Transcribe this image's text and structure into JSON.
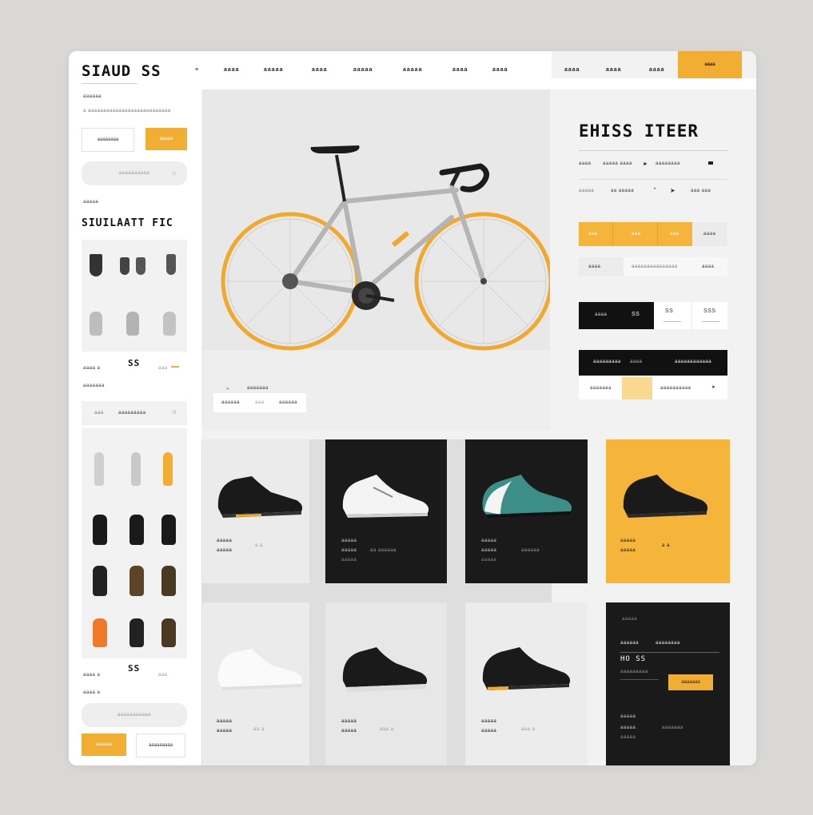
{
  "brand": {
    "logo": "SIAUD SS"
  },
  "nav": {
    "items": [
      "aaaa",
      "aaaaa",
      "aaaa",
      "aaaaa",
      "aaaaa",
      "aaaa",
      "aaaa"
    ],
    "right_items": [
      "aaaa",
      "aaaa",
      "aaaa"
    ],
    "cta_label": "aaaa"
  },
  "sidebar": {
    "eyebrow": "aaaaaa",
    "caption": "a aaaaaaaaaaaaaaaaaaaaaaaaaaa",
    "outline_button": "aaaaaaaa",
    "yellow_button": "aaaaa",
    "search_placeholder": "aaaaaaaaaa",
    "section_label": "aaaaa",
    "section_title": "SIUILAATT FIC",
    "price_1": "SS",
    "meta_1": "aaaa a",
    "meta_2": "aaaaaaa",
    "meta_small": "aaa",
    "filter_label": "aaaaaaaaa",
    "filter_small": "aaa",
    "price_2": "SS",
    "meta_3": "aaaa a",
    "meta_4": "aaaa a",
    "meta_small_2": "aaa",
    "search_2_placeholder": "aaaaaaaaaaa",
    "bottom_yellow": "aaaaaa",
    "bottom_outline": "aaaaaaaaa"
  },
  "hero": {
    "caption": "aaaaaaa",
    "segment": [
      "aaaaaa",
      "aaa",
      "aaaaaa"
    ]
  },
  "detail": {
    "title": "EHISS ITEER",
    "row1": [
      "aaaa",
      "aaaaa aaaa",
      "aaaaaaaa"
    ],
    "row2": [
      "aaaaa",
      "aa aaaaa",
      "aaa aaa"
    ],
    "yellow_blocks": [
      "aaa",
      "aaa",
      "aaa"
    ],
    "gray_block": "aaaa",
    "row3": [
      "aaaa",
      "aaaaaaaaaaaaaaa",
      "aaaa"
    ],
    "qty_dark": "aaaa",
    "qty_val": "SS",
    "qty_col2": "SS",
    "qty_col3": "SSS",
    "tab_dark": [
      "aaaaaaaaa",
      "aaaa",
      "aaaaaaaaaaaa"
    ],
    "tab_light": [
      "aaaaaaa",
      "aaaaaaaaaa"
    ]
  },
  "products": [
    {
      "name": "aaaaa",
      "meta": "aaaaa",
      "extra": "a  a"
    },
    {
      "name": "aaaaa",
      "meta": "aaaaa",
      "extra": "aa aaaaaa",
      "meta2": "aaaaa"
    },
    {
      "name": "aaaaa",
      "meta": "aaaaa",
      "extra": "aaaaaa",
      "meta2": "aaaaa"
    },
    {
      "name": "aaaaa",
      "meta": "aaaaa",
      "extra": "a  a"
    },
    {
      "name": "aaaaa",
      "meta": "aaaaa",
      "extra": "aa  a"
    },
    {
      "name": "aaaaa",
      "meta": "aaaaa",
      "extra": "aaa  a"
    },
    {
      "name": "aaaaa",
      "meta": "aaaaa",
      "extra": "aaa  a"
    }
  ],
  "promo": {
    "eyebrow": "aaaaa",
    "title_left": "aaaaaa",
    "title_right": "aaaaaaaa",
    "code": "HO SS",
    "sub": "aaaaaaaaa",
    "button": "aaaaaaa",
    "line1": "aaaaa",
    "line2": "aaaaa",
    "line2b": "aaaaaaa",
    "line3": "aaaaa"
  },
  "colors": {
    "accent": "#f5b53b",
    "dark": "#1a1a1a",
    "panel": "#f2f2f2"
  }
}
